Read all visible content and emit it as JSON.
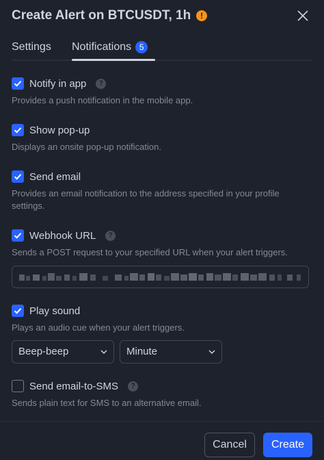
{
  "dialog": {
    "title": "Create Alert on BTCUSDT, 1h",
    "warning_icon": "!",
    "close_icon": "close-icon"
  },
  "tabs": [
    {
      "label": "Settings"
    },
    {
      "label": "Notifications",
      "badge": "5",
      "active": true
    }
  ],
  "notifications": {
    "notify_in_app": {
      "label": "Notify in app",
      "checked": true,
      "description": "Provides a push notification in the mobile app."
    },
    "show_popup": {
      "label": "Show pop-up",
      "checked": true,
      "description": "Displays an onsite pop-up notification."
    },
    "send_email": {
      "label": "Send email",
      "checked": true,
      "description": "Provides an email notification to the address specified in your profile settings."
    },
    "webhook": {
      "label": "Webhook URL",
      "checked": true,
      "description": "Sends a POST request to your specified URL when your alert triggers.",
      "value_redacted": true
    },
    "play_sound": {
      "label": "Play sound",
      "checked": true,
      "description": "Plays an audio cue when your alert triggers.",
      "sound": "Beep-beep",
      "duration": "Minute"
    },
    "email_to_sms": {
      "label": "Send email-to-SMS",
      "checked": false,
      "description": "Sends plain text for SMS to an alternative email."
    }
  },
  "footer": {
    "cancel_label": "Cancel",
    "create_label": "Create"
  },
  "colors": {
    "background": "#1e222d",
    "accent": "#2962ff",
    "warning": "#f7931a"
  }
}
